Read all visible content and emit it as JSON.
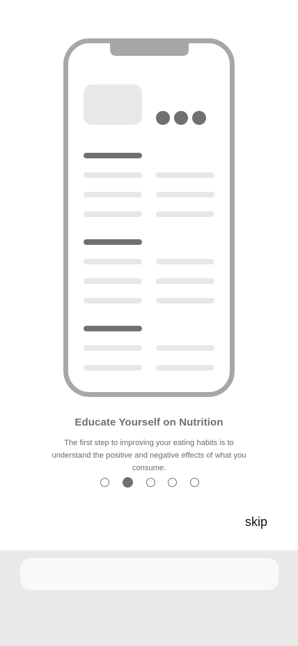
{
  "onboarding": {
    "title": "Educate Yourself on Nutrition",
    "description": "The first step to improving your eating habits is to understand the positive and negative effects of what you consume.",
    "pager": {
      "total": 5,
      "active_index": 1
    },
    "skip_label": "skip"
  },
  "colors": {
    "phone_frame": "#a7a7a7",
    "dark_bar": "#707070",
    "light_bar": "#e8e7e5",
    "bottom_panel": "#ebe9e7",
    "bottom_field": "#faf9f7"
  },
  "bottom_panel": {
    "field_value": ""
  }
}
